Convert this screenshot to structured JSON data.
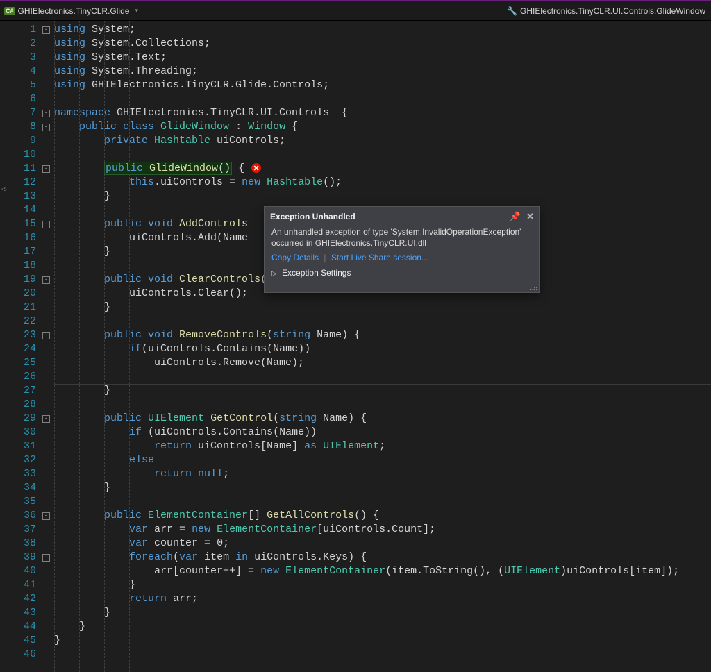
{
  "header": {
    "filetype_badge": "C#",
    "path": "GHIElectronics.TinyCLR.Glide",
    "right_path": "GHIElectronics.TinyCLR.UI.Controls.GlideWindow"
  },
  "exception_popup": {
    "title": "Exception Unhandled",
    "message": "An unhandled exception of type 'System.InvalidOperationException' occurred in GHIElectronics.TinyCLR.UI.dll",
    "link_copy": "Copy Details",
    "link_share": "Start Live Share session...",
    "expand_label": "Exception Settings"
  },
  "line_count": 46,
  "fold_lines": {
    "1": "-",
    "7": "-",
    "8": "-",
    "11": "-",
    "15": "-",
    "19": "-",
    "23": "-",
    "29": "-",
    "36": "-",
    "39": "-"
  },
  "highlighted_text": "public GlideWindow()",
  "cursor_line": 26,
  "code": {
    "1": [
      [
        "kw",
        "using "
      ],
      [
        "pn",
        "System;"
      ]
    ],
    "2": [
      [
        "kw",
        "using "
      ],
      [
        "pn",
        "System.Collections;"
      ]
    ],
    "3": [
      [
        "kw",
        "using "
      ],
      [
        "pn",
        "System.Text;"
      ]
    ],
    "4": [
      [
        "kw",
        "using "
      ],
      [
        "pn",
        "System.Threading;"
      ]
    ],
    "5": [
      [
        "kw",
        "using "
      ],
      [
        "pn",
        "GHIElectronics.TinyCLR.Glide.Controls;"
      ]
    ],
    "6": [],
    "7": [
      [
        "kw",
        "namespace "
      ],
      [
        "pn",
        "GHIElectronics.TinyCLR.UI.Controls  {"
      ]
    ],
    "8": [
      [
        "pn",
        "    "
      ],
      [
        "kw",
        "public class "
      ],
      [
        "tp",
        "GlideWindow"
      ],
      [
        "pn",
        " : "
      ],
      [
        "tp",
        "Window"
      ],
      [
        "pn",
        " {"
      ]
    ],
    "9": [
      [
        "pn",
        "        "
      ],
      [
        "kw",
        "private "
      ],
      [
        "tp",
        "Hashtable"
      ],
      [
        "pn",
        " uiControls;"
      ]
    ],
    "10": [],
    "11": [
      [
        "pn",
        "        "
      ],
      [
        "box",
        ""
      ],
      [
        "pn",
        " {"
      ],
      [
        "err",
        ""
      ]
    ],
    "12": [
      [
        "pn",
        "            "
      ],
      [
        "kw",
        "this"
      ],
      [
        "pn",
        ".uiControls = "
      ],
      [
        "kw",
        "new "
      ],
      [
        "tp",
        "Hashtable"
      ],
      [
        "pn",
        "();"
      ]
    ],
    "13": [
      [
        "pn",
        "        }"
      ]
    ],
    "14": [],
    "15": [
      [
        "pn",
        "        "
      ],
      [
        "kw",
        "public void "
      ],
      [
        "fn",
        "AddControls"
      ]
    ],
    "16": [
      [
        "pn",
        "            uiControls.Add(Name"
      ]
    ],
    "17": [
      [
        "pn",
        "        }"
      ]
    ],
    "18": [],
    "19": [
      [
        "pn",
        "        "
      ],
      [
        "kw",
        "public void "
      ],
      [
        "fn",
        "ClearControls"
      ],
      [
        "pn",
        "() {"
      ]
    ],
    "20": [
      [
        "pn",
        "            uiControls.Clear();"
      ]
    ],
    "21": [
      [
        "pn",
        "        }"
      ]
    ],
    "22": [],
    "23": [
      [
        "pn",
        "        "
      ],
      [
        "kw",
        "public void "
      ],
      [
        "fn",
        "RemoveControls"
      ],
      [
        "pn",
        "("
      ],
      [
        "kw",
        "string"
      ],
      [
        "pn",
        " Name) {"
      ]
    ],
    "24": [
      [
        "pn",
        "            "
      ],
      [
        "kw",
        "if"
      ],
      [
        "pn",
        "(uiControls.Contains(Name))"
      ]
    ],
    "25": [
      [
        "pn",
        "                uiControls.Remove(Name);"
      ]
    ],
    "26": [],
    "27": [
      [
        "pn",
        "        }"
      ]
    ],
    "28": [],
    "29": [
      [
        "pn",
        "        "
      ],
      [
        "kw",
        "public "
      ],
      [
        "tp",
        "UIElement"
      ],
      [
        "pn",
        " "
      ],
      [
        "fn",
        "GetControl"
      ],
      [
        "pn",
        "("
      ],
      [
        "kw",
        "string"
      ],
      [
        "pn",
        " Name) {"
      ]
    ],
    "30": [
      [
        "pn",
        "            "
      ],
      [
        "kw",
        "if"
      ],
      [
        "pn",
        " (uiControls.Contains(Name))"
      ]
    ],
    "31": [
      [
        "pn",
        "                "
      ],
      [
        "kw",
        "return"
      ],
      [
        "pn",
        " uiControls[Name] "
      ],
      [
        "kw",
        "as "
      ],
      [
        "tp",
        "UIElement"
      ],
      [
        "pn",
        ";"
      ]
    ],
    "32": [
      [
        "pn",
        "            "
      ],
      [
        "kw",
        "else"
      ]
    ],
    "33": [
      [
        "pn",
        "                "
      ],
      [
        "kw",
        "return null"
      ],
      [
        "pn",
        ";"
      ]
    ],
    "34": [
      [
        "pn",
        "        }"
      ]
    ],
    "35": [],
    "36": [
      [
        "pn",
        "        "
      ],
      [
        "kw",
        "public "
      ],
      [
        "tp",
        "ElementContainer"
      ],
      [
        "pn",
        "[] "
      ],
      [
        "fn",
        "GetAllControls"
      ],
      [
        "pn",
        "() {"
      ]
    ],
    "37": [
      [
        "pn",
        "            "
      ],
      [
        "kw",
        "var"
      ],
      [
        "pn",
        " arr = "
      ],
      [
        "kw",
        "new "
      ],
      [
        "tp",
        "ElementContainer"
      ],
      [
        "pn",
        "[uiControls.Count];"
      ]
    ],
    "38": [
      [
        "pn",
        "            "
      ],
      [
        "kw",
        "var"
      ],
      [
        "pn",
        " counter = 0;"
      ]
    ],
    "39": [
      [
        "pn",
        "            "
      ],
      [
        "kw",
        "foreach"
      ],
      [
        "pn",
        "("
      ],
      [
        "kw",
        "var"
      ],
      [
        "pn",
        " item "
      ],
      [
        "kw",
        "in"
      ],
      [
        "pn",
        " uiControls.Keys) {"
      ]
    ],
    "40": [
      [
        "pn",
        "                arr[counter++] = "
      ],
      [
        "kw",
        "new "
      ],
      [
        "tp",
        "ElementContainer"
      ],
      [
        "pn",
        "(item.ToString(), ("
      ],
      [
        "tp",
        "UIElement"
      ],
      [
        "pn",
        ")uiControls[item]);"
      ]
    ],
    "41": [
      [
        "pn",
        "            }"
      ]
    ],
    "42": [
      [
        "pn",
        "            "
      ],
      [
        "kw",
        "return"
      ],
      [
        "pn",
        " arr;"
      ]
    ],
    "43": [
      [
        "pn",
        "        }"
      ]
    ],
    "44": [
      [
        "pn",
        "    }"
      ]
    ],
    "45": [
      [
        "pn",
        "}"
      ]
    ],
    "46": []
  }
}
